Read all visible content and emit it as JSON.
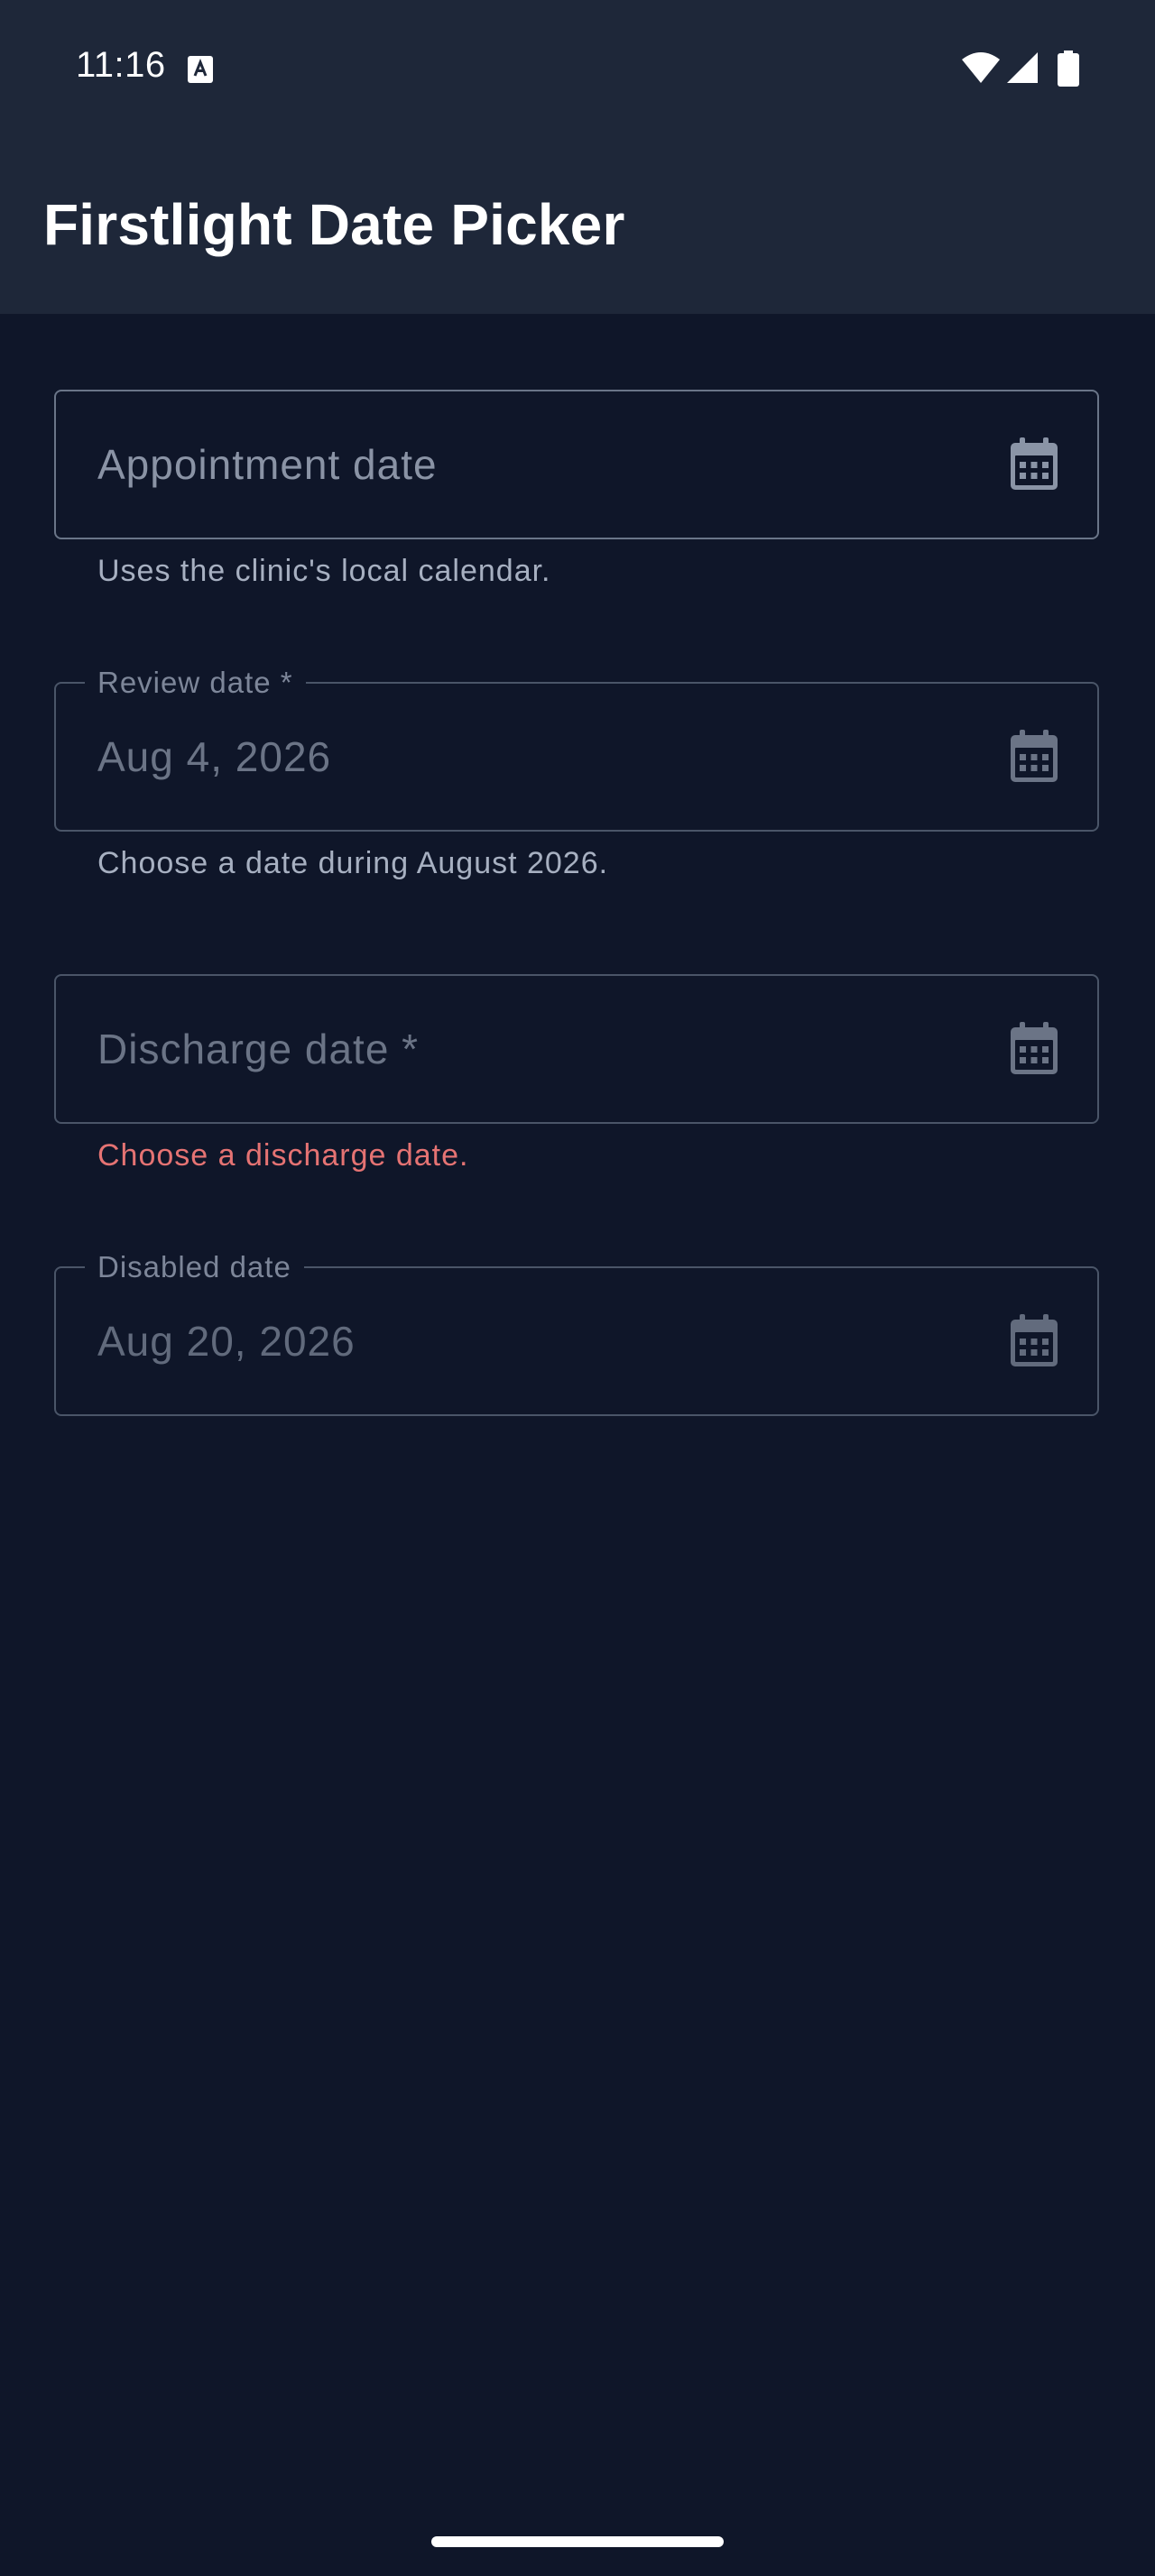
{
  "status_bar": {
    "time": "11:16",
    "icons": [
      "keyboard-a-icon",
      "wifi-icon",
      "signal-icon",
      "battery-icon"
    ]
  },
  "app_bar": {
    "title": "Firstlight Date Picker"
  },
  "fields": {
    "appointment": {
      "placeholder": "Appointment date",
      "helper": "Uses the clinic's local calendar.",
      "icon": "calendar-icon"
    },
    "review": {
      "label": "Review date *",
      "value": "Aug 4, 2026",
      "helper": "Choose a date during August 2026.",
      "icon": "calendar-icon"
    },
    "discharge": {
      "placeholder": "Discharge date *",
      "error": "Choose a discharge date.",
      "icon": "calendar-icon"
    },
    "disabled": {
      "label": "Disabled date",
      "value": "Aug 20, 2026",
      "icon": "calendar-icon"
    }
  },
  "colors": {
    "background": "#0f1629",
    "app_bar": "#1e2739",
    "error": "#e57373",
    "border": "#4a5568"
  }
}
